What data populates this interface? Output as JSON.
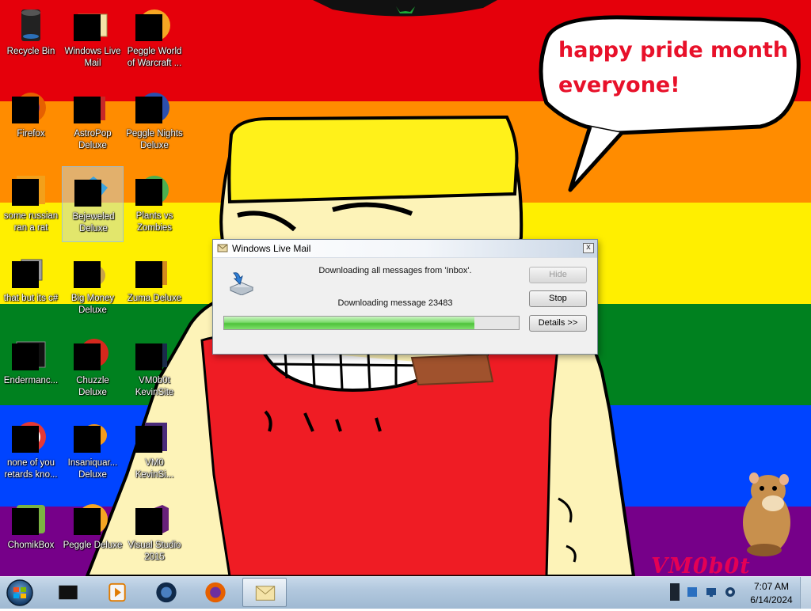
{
  "desktop": {
    "colors": {
      "stripe_red": "#e5000b",
      "stripe_orange": "#ff8c00",
      "stripe_yellow": "#ffef00",
      "stripe_green": "#00811f",
      "stripe_blue": "#0044ff",
      "stripe_purple": "#760089",
      "speech_text": "#e8112a",
      "watermark": "#e40055"
    },
    "icons": [
      {
        "label": "Recycle Bin",
        "icon": "recycle-bin-icon"
      },
      {
        "label": "Windows Live\nMail",
        "icon": "windows-live-mail-icon"
      },
      {
        "label": "Peggle World\nof Warcraft ...",
        "icon": "peggle-world-of-warcraft-icon"
      },
      {
        "label": "Firefox",
        "icon": "firefox-icon"
      },
      {
        "label": "AstroPop\nDeluxe",
        "icon": "astropop-deluxe-icon"
      },
      {
        "label": "Peggle Nights\nDeluxe",
        "icon": "peggle-nights-deluxe-icon"
      },
      {
        "label": "some russian\nran a rat",
        "icon": "ie-like-icon"
      },
      {
        "label": "Bejeweled\nDeluxe",
        "icon": "bejeweled-deluxe-icon"
      },
      {
        "label": "Plants vs\nZombies",
        "icon": "plants-vs-zombies-icon"
      },
      {
        "label": "that but its c#",
        "icon": "shortcut-icon"
      },
      {
        "label": "Big Money\nDeluxe",
        "icon": "big-money-deluxe-icon"
      },
      {
        "label": "Zuma Deluxe",
        "icon": "zuma-deluxe-icon"
      },
      {
        "label": "Endermanc...",
        "icon": "terminal-icon"
      },
      {
        "label": "Chuzzle\nDeluxe",
        "icon": "chuzzle-deluxe-icon"
      },
      {
        "label": "VM0b0t\nKevinSite",
        "icon": "vm0b0t-kevinsite-icon"
      },
      {
        "label": "none of you\nretards kno...",
        "icon": "red-circle-icon"
      },
      {
        "label": "Insaniquar...\nDeluxe",
        "icon": "insaniquarium-deluxe-icon"
      },
      {
        "label": "VM0\nKevinSi...",
        "icon": "vm0-kevinsite-icon"
      },
      {
        "label": "ChomikBox",
        "icon": "chomikbox-icon"
      },
      {
        "label": "Peggle Deluxe",
        "icon": "peggle-deluxe-icon"
      },
      {
        "label": "Visual Studio\n2015",
        "icon": "visual-studio-icon"
      }
    ],
    "speech_bubble": {
      "line1": "happy pride month",
      "line2": "everyone!"
    },
    "watermark": "VM0b0t"
  },
  "dialog": {
    "title": "Windows Live Mail",
    "status": "Downloading all messages from 'Inbox'.",
    "message": "Downloading message 23483",
    "progress_fraction": 0.85,
    "buttons": {
      "hide": "Hide",
      "stop": "Stop",
      "details": "Details >>"
    },
    "close_glyph": "x"
  },
  "taskbar": {
    "pinned": [
      {
        "icon": "black-box-app-icon",
        "active": false
      },
      {
        "icon": "media-player-icon",
        "active": false
      },
      {
        "icon": "orb-app-icon",
        "active": false
      },
      {
        "icon": "firefox-icon",
        "active": false
      },
      {
        "icon": "windows-live-mail-icon",
        "active": true
      }
    ],
    "tray": [
      {
        "icon": "network-icon"
      },
      {
        "icon": "monitor-icon"
      },
      {
        "icon": "volume-icon"
      }
    ],
    "clock": {
      "time": "7:07 AM",
      "date": "6/14/2024"
    }
  }
}
